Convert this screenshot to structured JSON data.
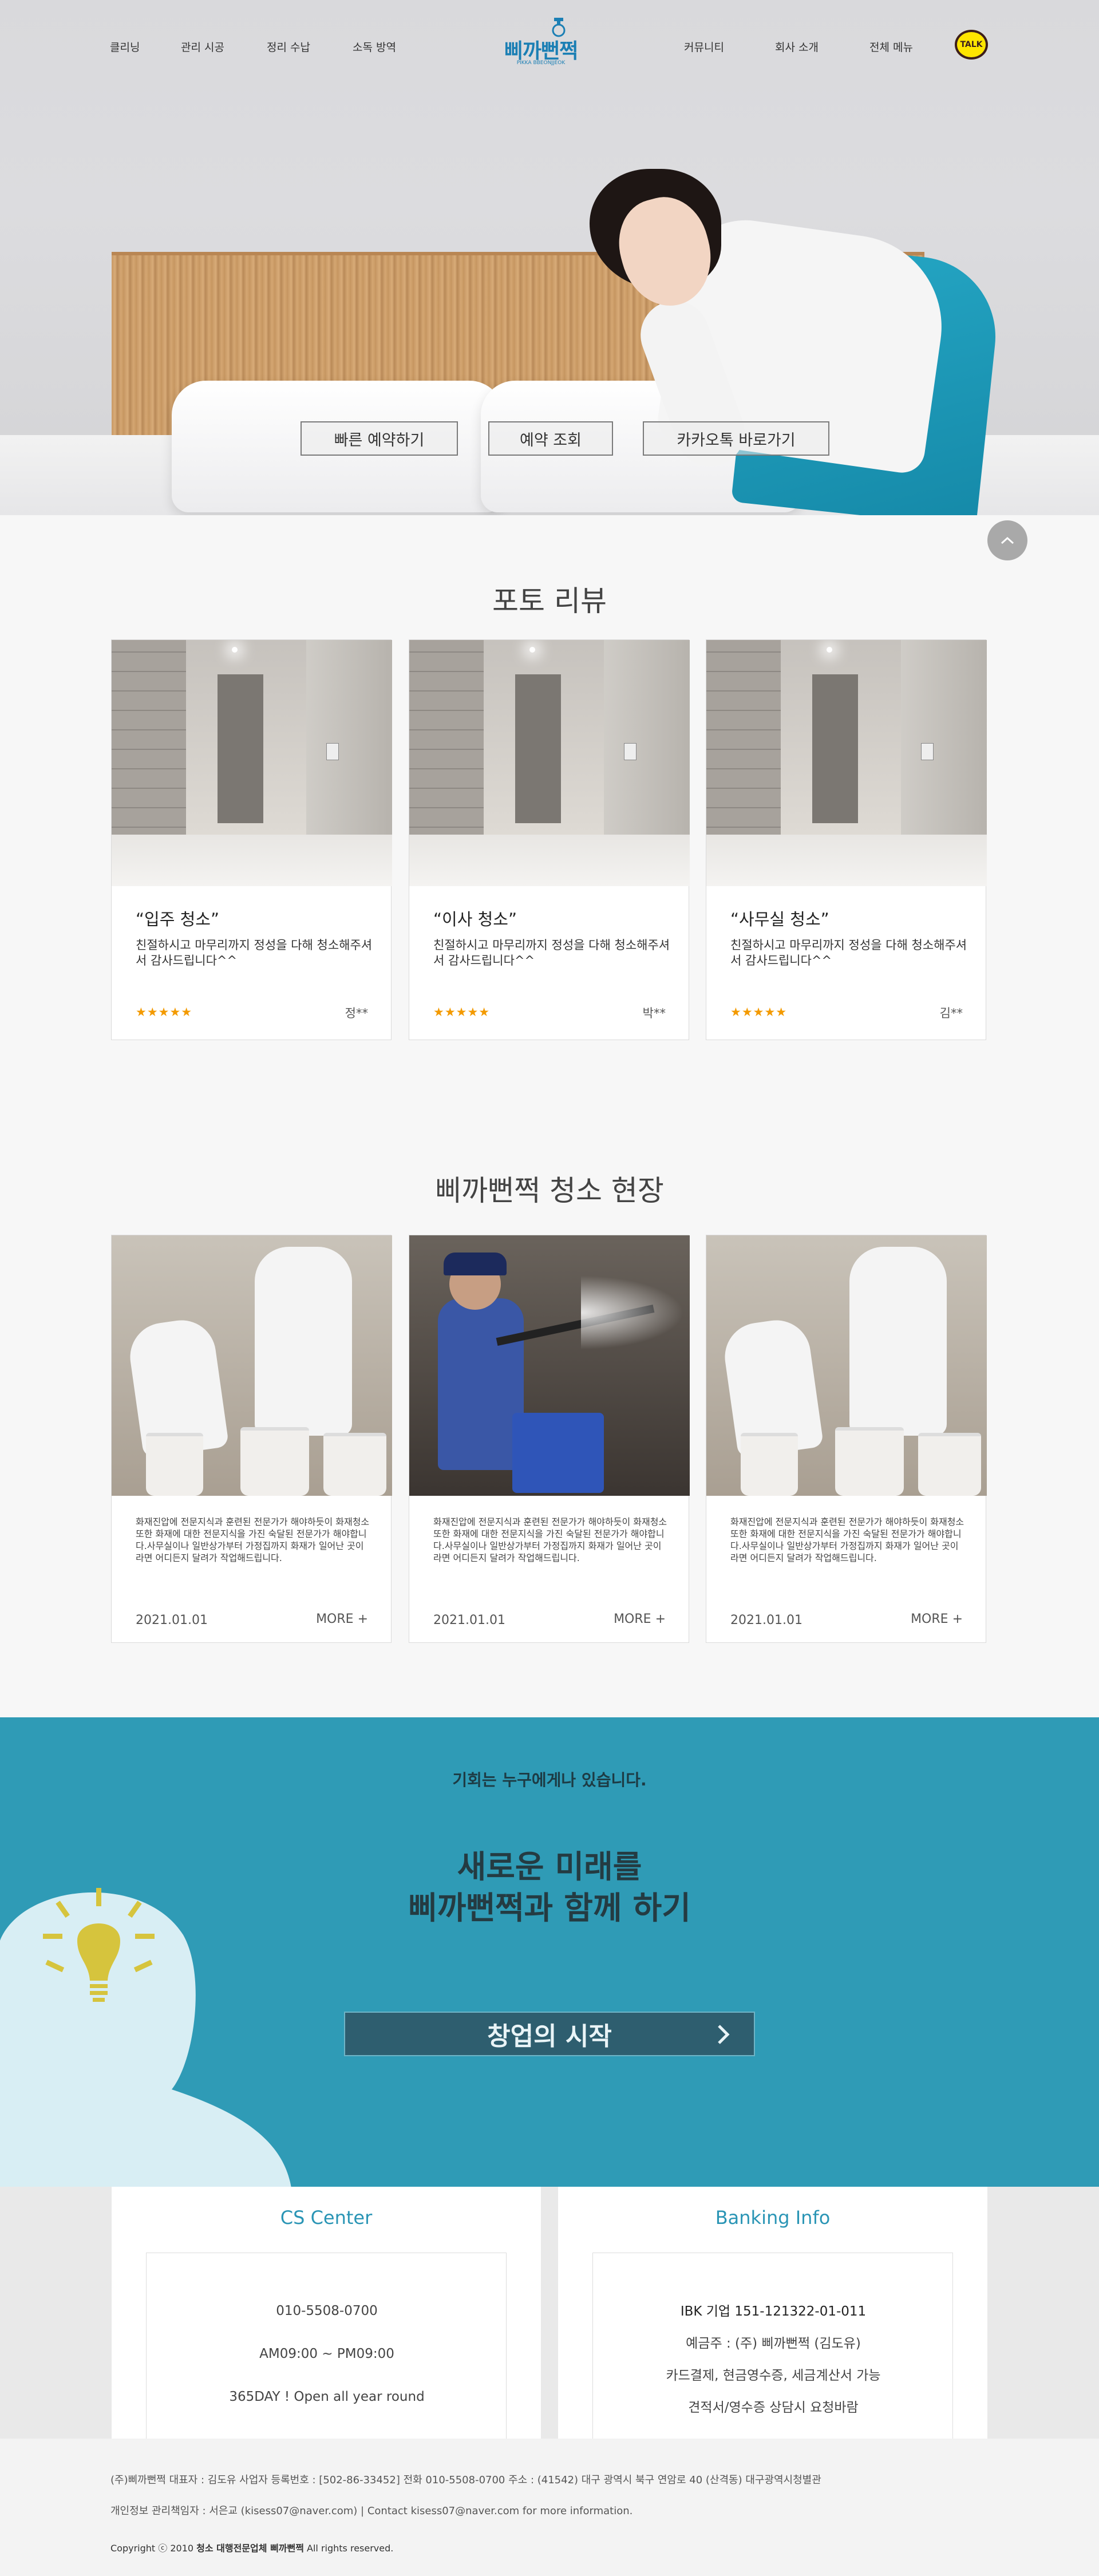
{
  "nav": {
    "left": [
      "클리닝",
      "관리 시공",
      "정리 수납",
      "소독 방역"
    ],
    "right": [
      "커뮤니티",
      "회사 소개",
      "전체 메뉴"
    ],
    "logo_text": "삐까뻔쩍",
    "logo_sub": "PIKKA BBEONJJEOK",
    "talk_label": "TALK"
  },
  "hero": {
    "buttons": [
      "빠른 예약하기",
      "예약 조회",
      "카카오톡 바로가기"
    ]
  },
  "photo_review": {
    "title": "포토 리뷰",
    "cards": [
      {
        "title": "“입주 청소”",
        "text": "친절하시고 마무리까지 정성을 다해 청소해주셔서 감사드립니다^^",
        "stars": "★★★★★",
        "reviewer": "정**"
      },
      {
        "title": "“이사 청소”",
        "text": "친절하시고 마무리까지 정성을 다해 청소해주셔서 감사드립니다^^",
        "stars": "★★★★★",
        "reviewer": "박**"
      },
      {
        "title": "“사무실 청소”",
        "text": "친절하시고 마무리까지 정성을 다해 청소해주셔서 감사드립니다^^",
        "stars": "★★★★★",
        "reviewer": "김**"
      }
    ]
  },
  "sites": {
    "title": "삐까뻔쩍 청소 현장",
    "cards": [
      {
        "text": "화재진압에 전문지식과 훈련된 전문가가 해야하듯이 화재청소 또한 화재에 대한 전문지식을 가진 숙달된 전문가가 해야합니다.사무실이나 일반상가부터 가정집까지 화재가 일어난 곳이라면 어디든지 달려가 작업해드립니다.",
        "date": "2021.01.01",
        "more": "MORE"
      },
      {
        "text": "화재진압에 전문지식과 훈련된 전문가가 해야하듯이 화재청소 또한 화재에 대한 전문지식을 가진 숙달된 전문가가 해야합니다.사무실이나 일반상가부터 가정집까지 화재가 일어난 곳이라면 어디든지 달려가 작업해드립니다.",
        "date": "2021.01.01",
        "more": "MORE"
      },
      {
        "text": "화재진압에 전문지식과 훈련된 전문가가 해야하듯이 화재청소 또한 화재에 대한 전문지식을 가진 숙달된 전문가가 해야합니다.사무실이나 일반상가부터 가정집까지 화재가 일어난 곳이라면 어디든지 달려가 작업해드립니다.",
        "date": "2021.01.01",
        "more": "MORE"
      }
    ]
  },
  "banner": {
    "sub": "기회는 누구에게나 있습니다.",
    "title_line1": "새로운 미래를",
    "title_line2": "삐까뻔쩍과 함께 하기",
    "button": "창업의 시작"
  },
  "cs_center": {
    "heading": "CS Center",
    "phone": "010-5508-0700",
    "hours": "AM09:00 ~ PM09:00",
    "days": "365DAY ! Open all year round"
  },
  "banking": {
    "heading": "Banking Info",
    "account": "IBK 기업 151-121322-01-011",
    "holder": "예금주 : (주) 삐까뻔쩍 (김도유)",
    "payment": "카드결제, 현금영수증, 세금계산서 가능",
    "estimate": "견적서/영수증 상담시 요청바람"
  },
  "footer": {
    "line1": "(주)삐까뻔쩍  대표자 : 김도유   사업자 등록번호 : [502-86-33452]   전화 010-5508-0700 주소 : (41542) 대구 광역시 북구 연암로 40 (산격동) 대구광역시청별관",
    "line2": "개인정보 관리책임자 : 서은교 (kisess07@naver.com) | Contact kisess07@naver.com for more information.",
    "copy_prefix": "Copyright ⓒ 2010 ",
    "copy_bold": "청소 대행전문업체 삐까뻔쩍",
    "copy_suffix": " All rights reserved."
  },
  "colors": {
    "brand_blue": "#2f9bb6",
    "star_orange": "#f39a00",
    "talk_yellow": "#ffe500"
  }
}
